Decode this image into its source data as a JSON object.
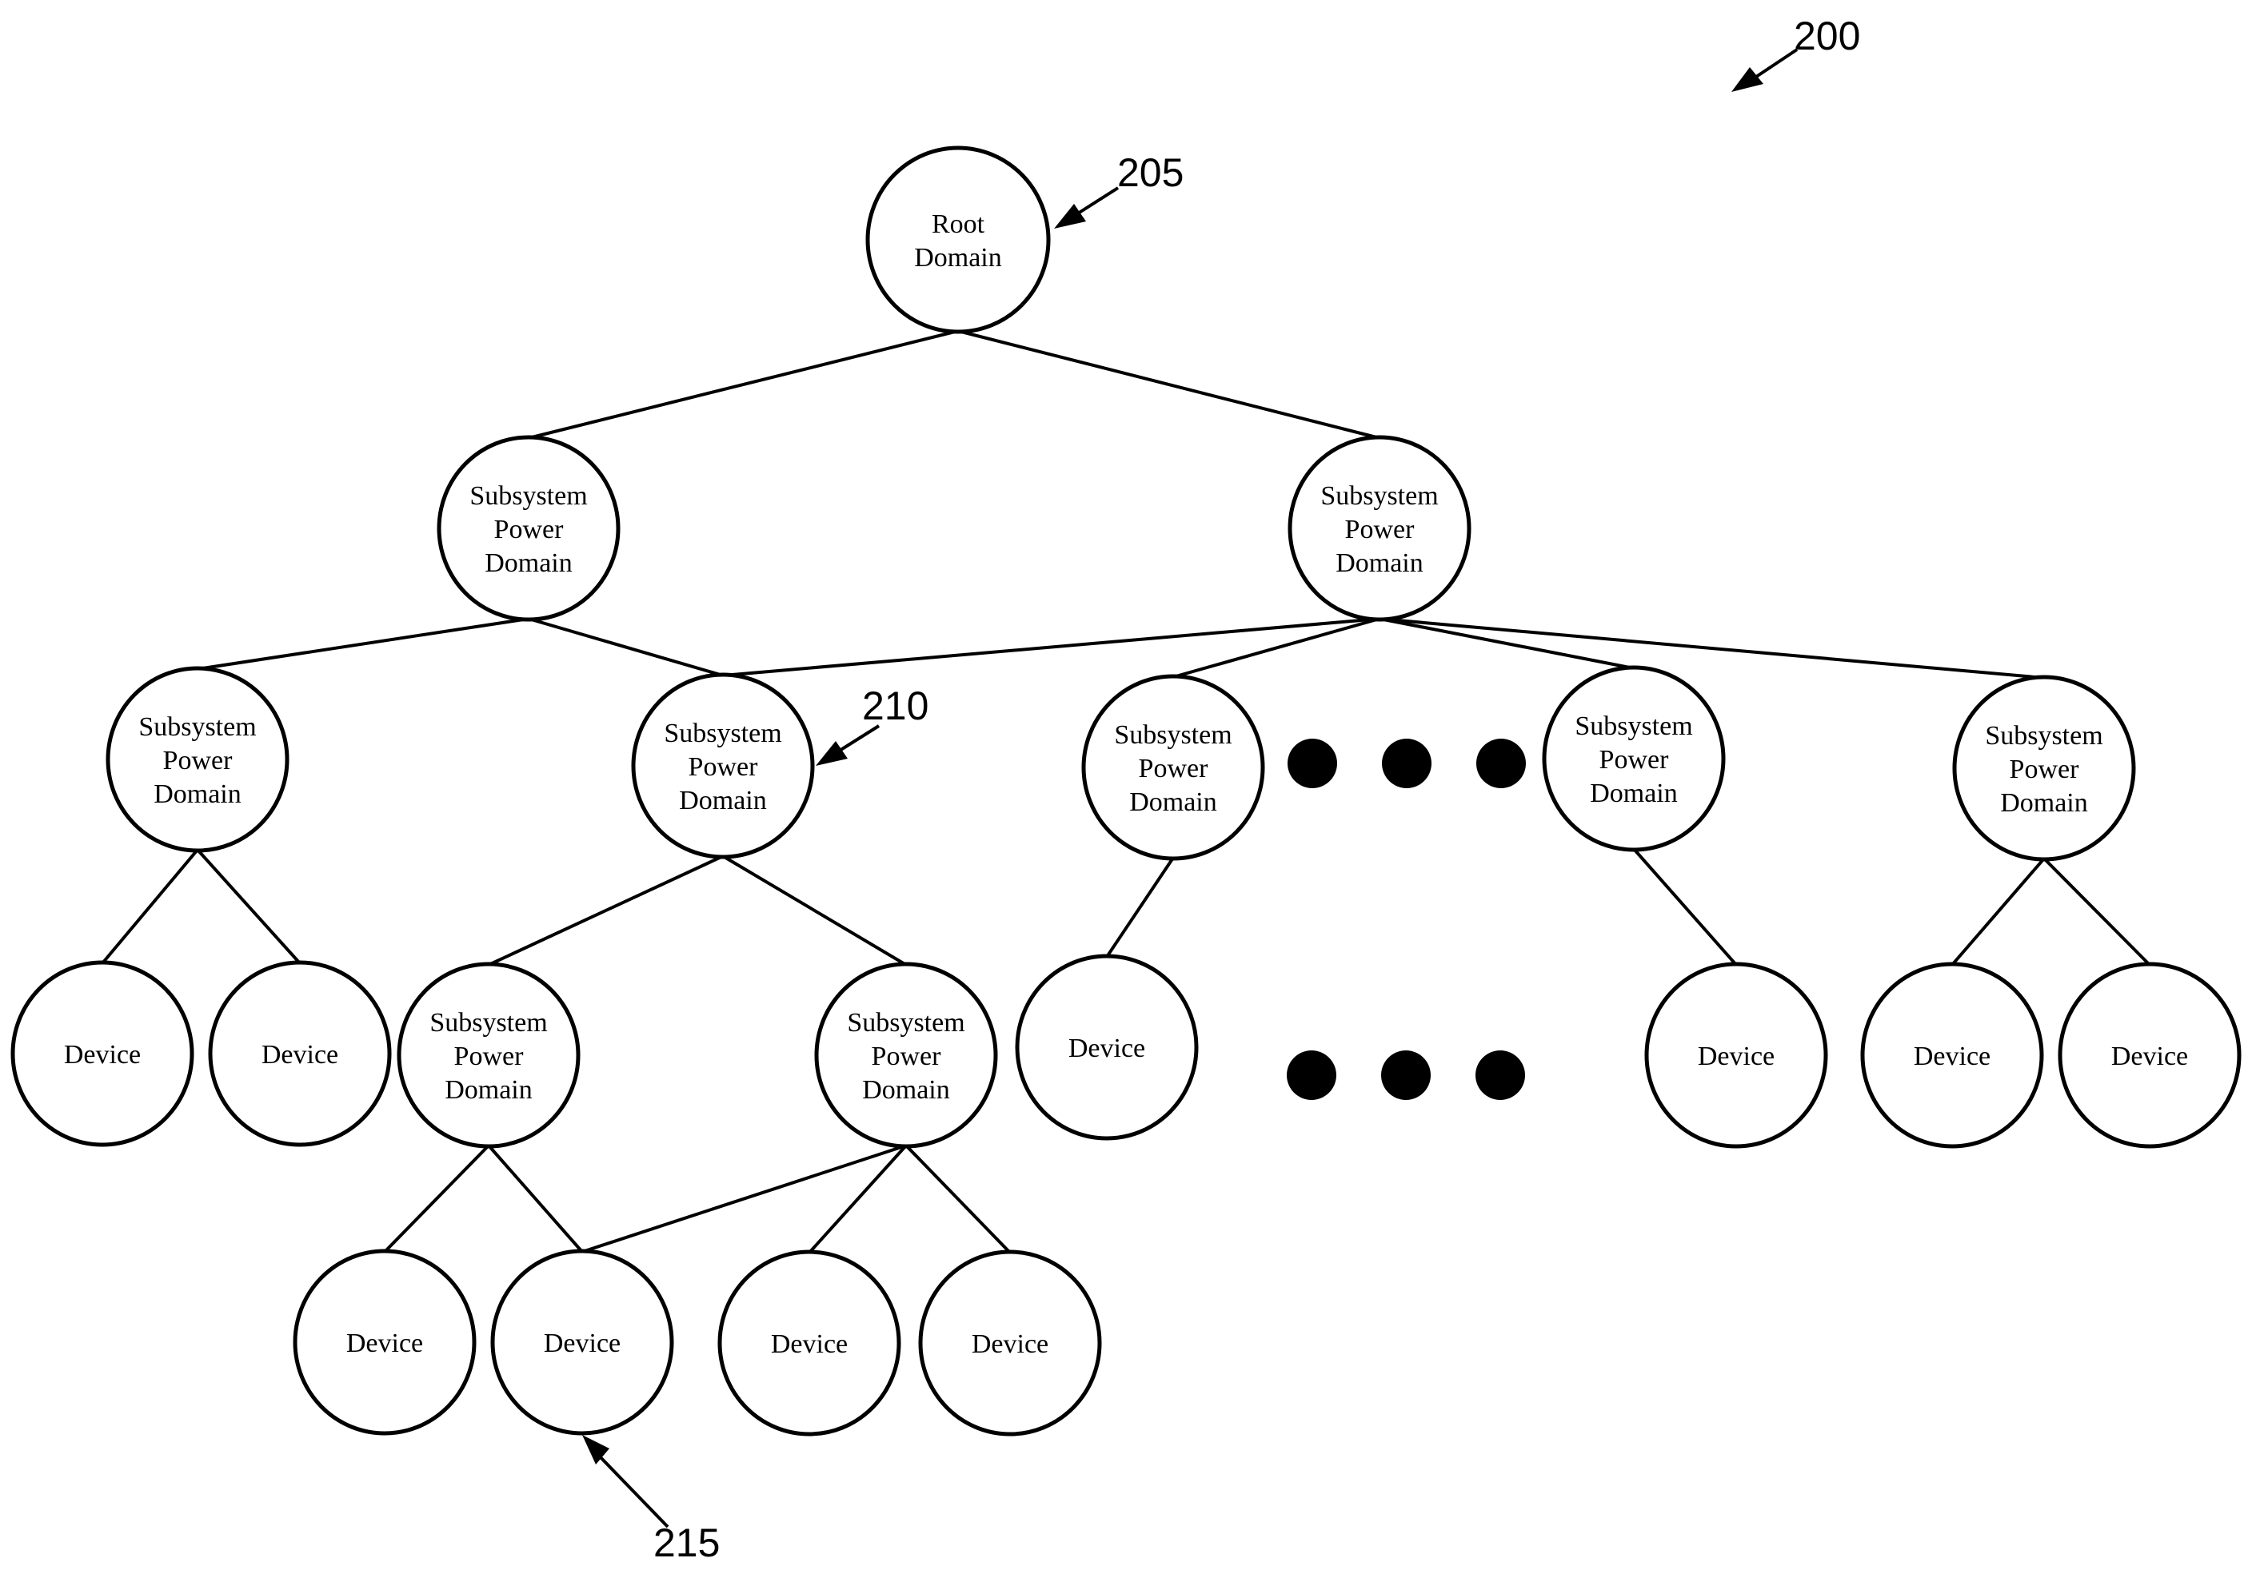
{
  "figure": {
    "reference_number": "200",
    "description": "Hierarchical tree of power domains"
  },
  "nodes": [
    {
      "id": "root",
      "lines": [
        "Root",
        "Domain"
      ],
      "type": "root-domain"
    },
    {
      "id": "l1a",
      "lines": [
        "Subsystem",
        "Power",
        "Domain"
      ],
      "type": "subsystem-power-domain"
    },
    {
      "id": "l1b",
      "lines": [
        "Subsystem",
        "Power",
        "Domain"
      ],
      "type": "subsystem-power-domain"
    },
    {
      "id": "l2a",
      "lines": [
        "Subsystem",
        "Power",
        "Domain"
      ],
      "type": "subsystem-power-domain"
    },
    {
      "id": "l2b",
      "lines": [
        "Subsystem",
        "Power",
        "Domain"
      ],
      "type": "subsystem-power-domain"
    },
    {
      "id": "l2c",
      "lines": [
        "Subsystem",
        "Power",
        "Domain"
      ],
      "type": "subsystem-power-domain"
    },
    {
      "id": "l2d",
      "lines": [
        "Subsystem",
        "Power",
        "Domain"
      ],
      "type": "subsystem-power-domain"
    },
    {
      "id": "l2e",
      "lines": [
        "Subsystem",
        "Power",
        "Domain"
      ],
      "type": "subsystem-power-domain"
    },
    {
      "id": "l3a",
      "lines": [
        "Device"
      ],
      "type": "device"
    },
    {
      "id": "l3b",
      "lines": [
        "Device"
      ],
      "type": "device"
    },
    {
      "id": "l3c",
      "lines": [
        "Subsystem",
        "Power",
        "Domain"
      ],
      "type": "subsystem-power-domain"
    },
    {
      "id": "l3d",
      "lines": [
        "Subsystem",
        "Power",
        "Domain"
      ],
      "type": "subsystem-power-domain"
    },
    {
      "id": "l3e",
      "lines": [
        "Device"
      ],
      "type": "device"
    },
    {
      "id": "l3f",
      "lines": [
        "Device"
      ],
      "type": "device"
    },
    {
      "id": "l3g",
      "lines": [
        "Device"
      ],
      "type": "device"
    },
    {
      "id": "l3h",
      "lines": [
        "Device"
      ],
      "type": "device"
    },
    {
      "id": "l4a",
      "lines": [
        "Device"
      ],
      "type": "device"
    },
    {
      "id": "l4b",
      "lines": [
        "Device"
      ],
      "type": "device"
    },
    {
      "id": "l4c",
      "lines": [
        "Device"
      ],
      "type": "device"
    },
    {
      "id": "l4d",
      "lines": [
        "Device"
      ],
      "type": "device"
    }
  ],
  "edges": [
    [
      "root",
      "l1a"
    ],
    [
      "root",
      "l1b"
    ],
    [
      "l1a",
      "l2a"
    ],
    [
      "l1a",
      "l2b"
    ],
    [
      "l1b",
      "l2b"
    ],
    [
      "l1b",
      "l2c"
    ],
    [
      "l1b",
      "l2d"
    ],
    [
      "l1b",
      "l2e"
    ],
    [
      "l2a",
      "l3a"
    ],
    [
      "l2a",
      "l3b"
    ],
    [
      "l2b",
      "l3c"
    ],
    [
      "l2b",
      "l3d"
    ],
    [
      "l2c",
      "l3e"
    ],
    [
      "l2d",
      "l3f"
    ],
    [
      "l2e",
      "l3g"
    ],
    [
      "l2e",
      "l3h"
    ],
    [
      "l3c",
      "l4a"
    ],
    [
      "l3c",
      "l4b"
    ],
    [
      "l3d",
      "l4b"
    ],
    [
      "l3d",
      "l4c"
    ],
    [
      "l3d",
      "l4d"
    ]
  ],
  "ellipses": [
    {
      "row": "subsystem-level",
      "meaning": "additional subsystem power domains",
      "count": 3
    },
    {
      "row": "device-level",
      "meaning": "additional devices",
      "count": 3
    }
  ],
  "callouts": [
    {
      "label": "200",
      "target": "figure"
    },
    {
      "label": "205",
      "target": "root"
    },
    {
      "label": "210",
      "target": "l2b"
    },
    {
      "label": "215",
      "target": "l4b"
    }
  ]
}
